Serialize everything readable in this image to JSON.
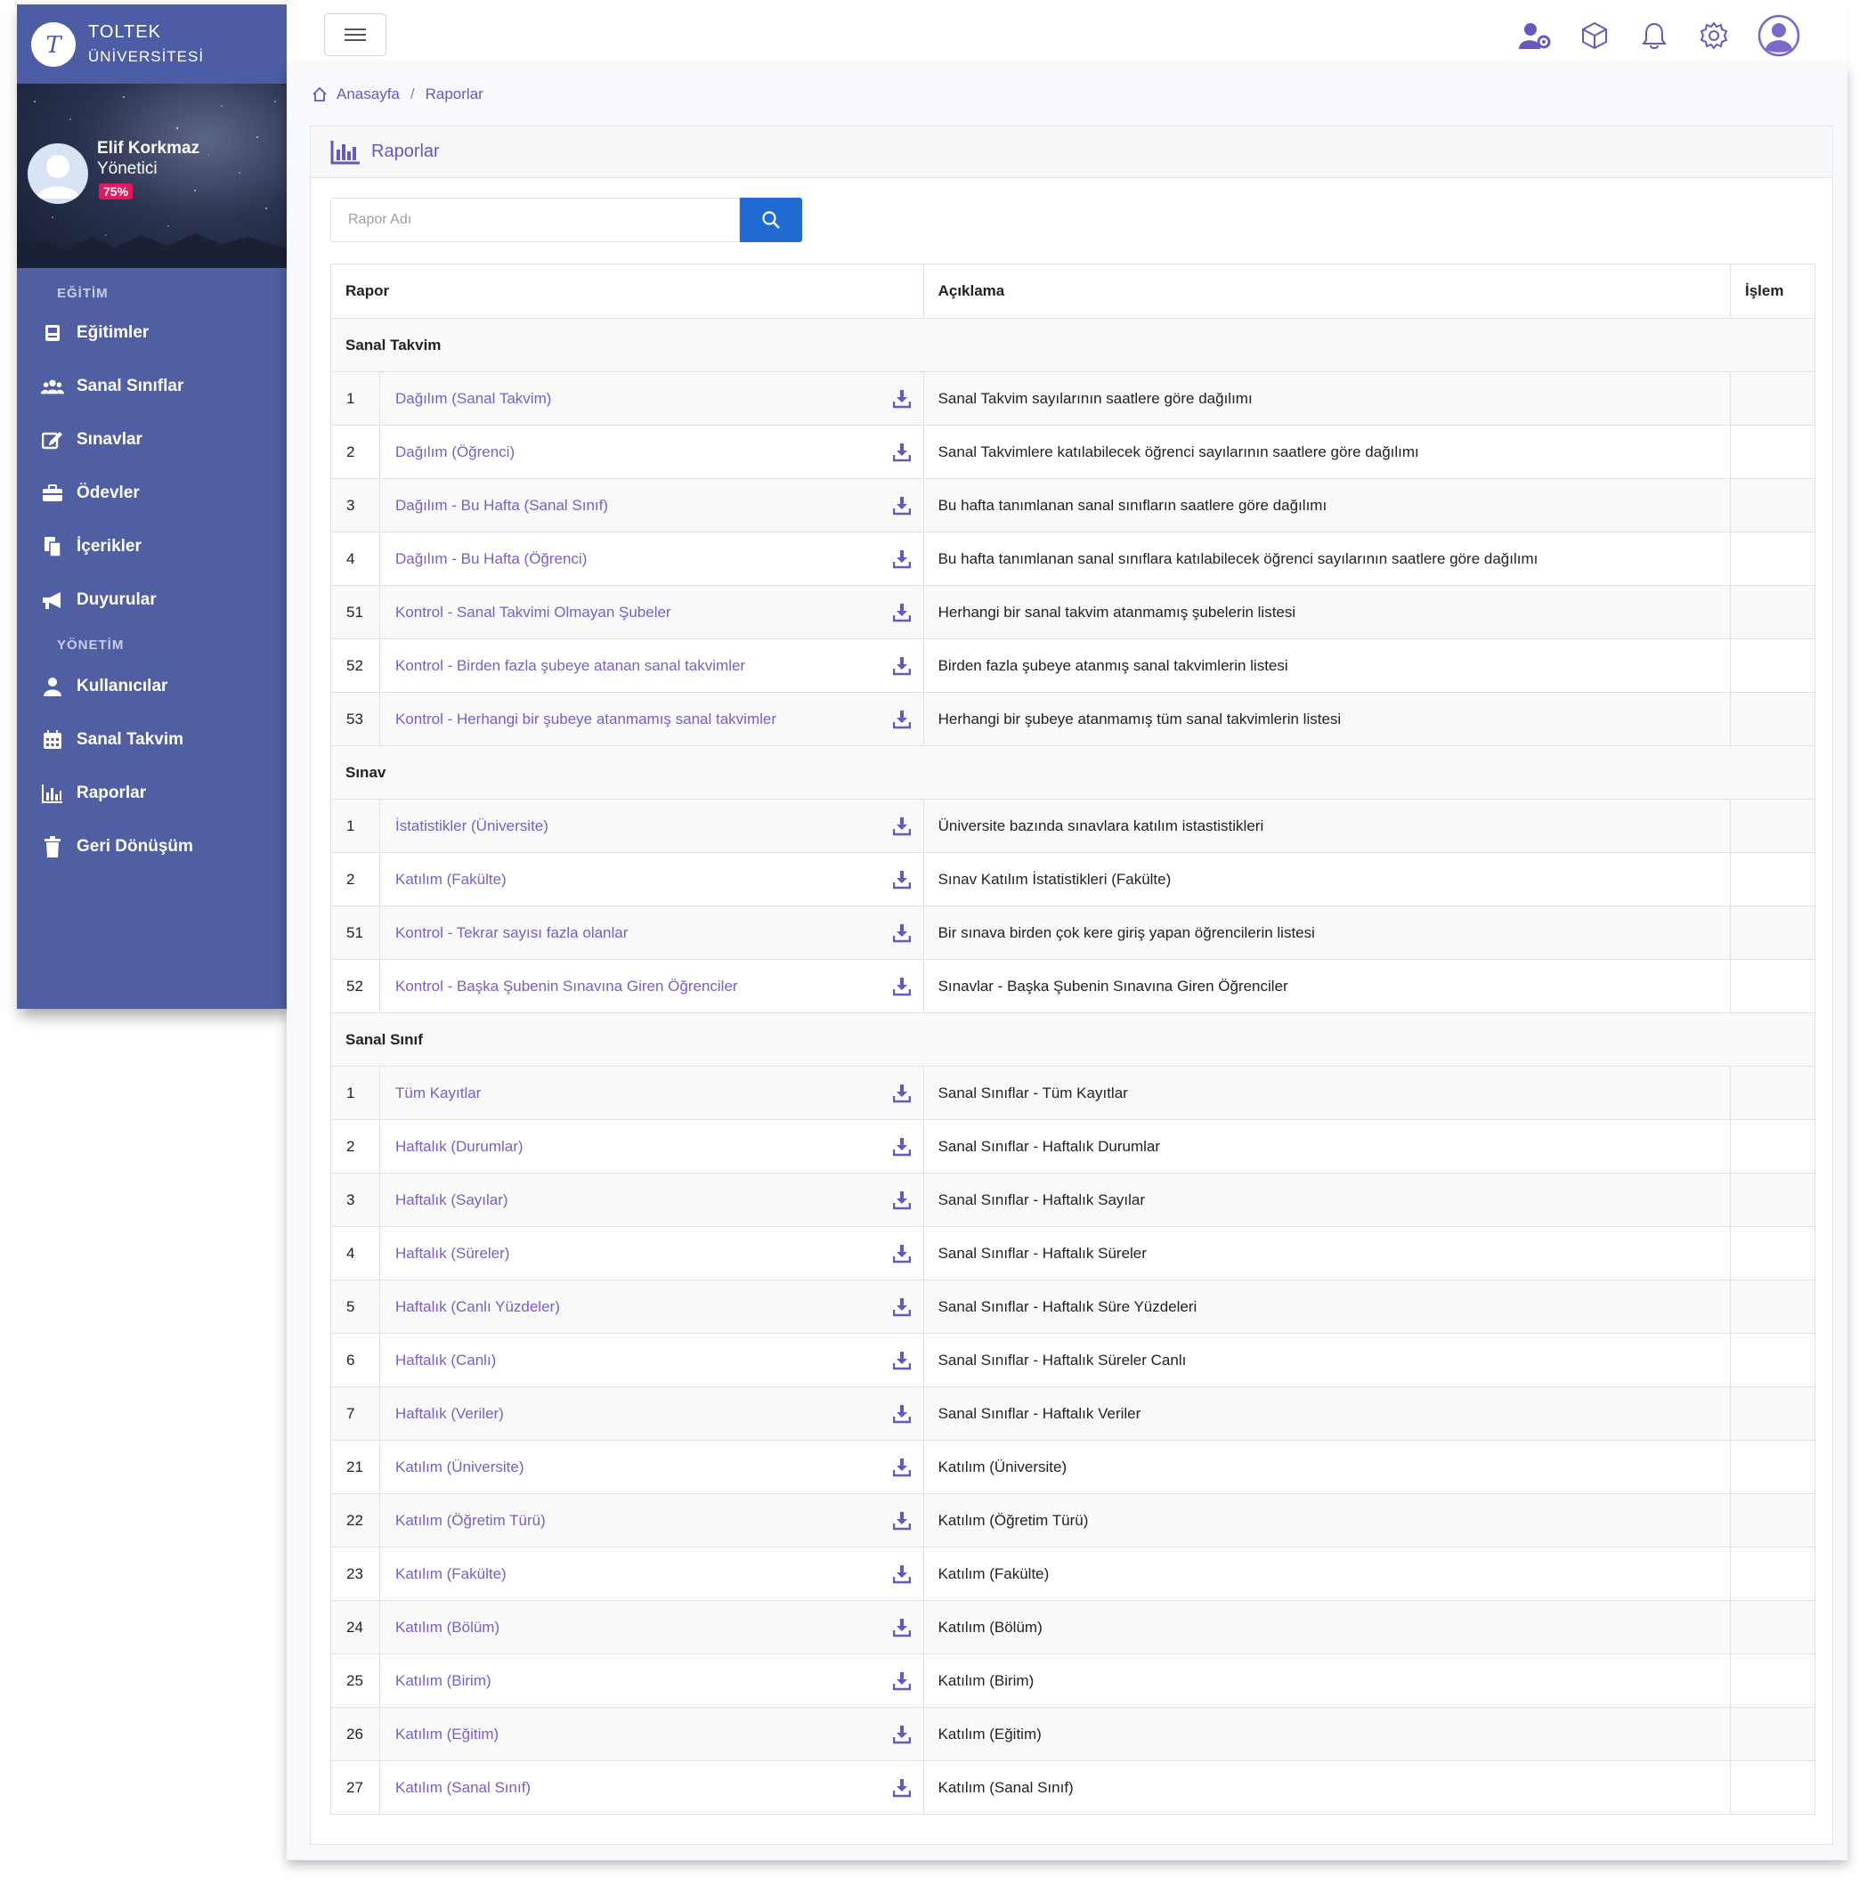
{
  "brand": {
    "line1": "TOLTEK",
    "line2": "ÜNİVERSİTESİ"
  },
  "profile": {
    "name": "Elif Korkmaz",
    "role": "Yönetici",
    "badge": "75%"
  },
  "sidebar": {
    "section1": "EĞİTİM",
    "items1": [
      {
        "label": "Eğitimler",
        "icon": "book-icon"
      },
      {
        "label": "Sanal Sınıflar",
        "icon": "users-icon"
      },
      {
        "label": "Sınavlar",
        "icon": "edit-icon"
      },
      {
        "label": "Ödevler",
        "icon": "briefcase-icon"
      },
      {
        "label": "İçerikler",
        "icon": "files-icon"
      },
      {
        "label": "Duyurular",
        "icon": "megaphone-icon"
      }
    ],
    "section2": "YÖNETİM",
    "items2": [
      {
        "label": "Kullanıcılar",
        "icon": "user-icon"
      },
      {
        "label": "Sanal Takvim",
        "icon": "calendar-icon"
      },
      {
        "label": "Raporlar",
        "icon": "chart-icon"
      },
      {
        "label": "Geri Dönüşüm",
        "icon": "trash-icon"
      }
    ]
  },
  "breadcrumb": {
    "home": "Anasayfa",
    "separator": "/",
    "current": "Raporlar"
  },
  "card": {
    "title": "Raporlar"
  },
  "search": {
    "placeholder": "Rapor Adı"
  },
  "table": {
    "headers": {
      "report": "Rapor",
      "description": "Açıklama",
      "action": "İşlem"
    },
    "groups": [
      {
        "name": "Sanal Takvim",
        "rows": [
          {
            "no": "1",
            "report": "Dağılım (Sanal Takvim)",
            "description": "Sanal Takvim sayılarının saatlere göre dağılımı"
          },
          {
            "no": "2",
            "report": "Dağılım (Öğrenci)",
            "description": "Sanal Takvimlere katılabilecek öğrenci sayılarının saatlere göre dağılımı"
          },
          {
            "no": "3",
            "report": "Dağılım - Bu Hafta (Sanal Sınıf)",
            "description": "Bu hafta tanımlanan sanal sınıfların saatlere göre dağılımı"
          },
          {
            "no": "4",
            "report": "Dağılım - Bu Hafta (Öğrenci)",
            "description": "Bu hafta tanımlanan sanal sınıflara katılabilecek öğrenci sayılarının saatlere göre dağılımı"
          },
          {
            "no": "51",
            "report": "Kontrol - Sanal Takvimi Olmayan Şubeler",
            "description": "Herhangi bir sanal takvim atanmamış şubelerin listesi"
          },
          {
            "no": "52",
            "report": "Kontrol - Birden fazla şubeye atanan sanal takvimler",
            "description": "Birden fazla şubeye atanmış sanal takvimlerin listesi"
          },
          {
            "no": "53",
            "report": "Kontrol - Herhangi bir şubeye atanmamış sanal takvimler",
            "description": "Herhangi bir şubeye atanmamış tüm sanal takvimlerin listesi"
          }
        ]
      },
      {
        "name": "Sınav",
        "rows": [
          {
            "no": "1",
            "report": "İstatistikler (Üniversite)",
            "description": "Üniversite bazında sınavlara katılım istastistikleri"
          },
          {
            "no": "2",
            "report": "Katılım (Fakülte)",
            "description": "Sınav Katılım İstatistikleri (Fakülte)"
          },
          {
            "no": "51",
            "report": "Kontrol - Tekrar sayısı fazla olanlar",
            "description": "Bir sınava birden çok kere giriş yapan öğrencilerin listesi"
          },
          {
            "no": "52",
            "report": "Kontrol - Başka Şubenin Sınavına Giren Öğrenciler",
            "description": "Sınavlar - Başka Şubenin Sınavına Giren Öğrenciler"
          }
        ]
      },
      {
        "name": "Sanal Sınıf",
        "rows": [
          {
            "no": "1",
            "report": "Tüm Kayıtlar",
            "description": "Sanal Sınıflar - Tüm Kayıtlar"
          },
          {
            "no": "2",
            "report": "Haftalık (Durumlar)",
            "description": "Sanal Sınıflar - Haftalık Durumlar"
          },
          {
            "no": "3",
            "report": "Haftalık (Sayılar)",
            "description": "Sanal Sınıflar - Haftalık Sayılar"
          },
          {
            "no": "4",
            "report": "Haftalık (Süreler)",
            "description": "Sanal Sınıflar - Haftalık Süreler"
          },
          {
            "no": "5",
            "report": "Haftalık (Canlı Yüzdeler)",
            "description": "Sanal Sınıflar - Haftalık Süre Yüzdeleri"
          },
          {
            "no": "6",
            "report": "Haftalık (Canlı)",
            "description": "Sanal Sınıflar - Haftalık Süreler Canlı"
          },
          {
            "no": "7",
            "report": "Haftalık (Veriler)",
            "description": "Sanal Sınıflar - Haftalık Veriler"
          },
          {
            "no": "21",
            "report": "Katılım (Üniversite)",
            "description": "Katılım (Üniversite)"
          },
          {
            "no": "22",
            "report": "Katılım (Öğretim Türü)",
            "description": "Katılım (Öğretim Türü)"
          },
          {
            "no": "23",
            "report": "Katılım (Fakülte)",
            "description": "Katılım (Fakülte)"
          },
          {
            "no": "24",
            "report": "Katılım (Bölüm)",
            "description": "Katılım (Bölüm)"
          },
          {
            "no": "25",
            "report": "Katılım (Birim)",
            "description": "Katılım (Birim)"
          },
          {
            "no": "26",
            "report": "Katılım (Eğitim)",
            "description": "Katılım (Eğitim)"
          },
          {
            "no": "27",
            "report": "Katılım (Sanal Sınıf)",
            "description": "Katılım (Sanal Sınıf)"
          }
        ]
      }
    ]
  },
  "colors": {
    "sidebar": "#505ea2",
    "accent": "#6b56bd",
    "link": "#7a5ec4",
    "primary_button": "#1f6bd1",
    "badge": "#e2195a"
  }
}
